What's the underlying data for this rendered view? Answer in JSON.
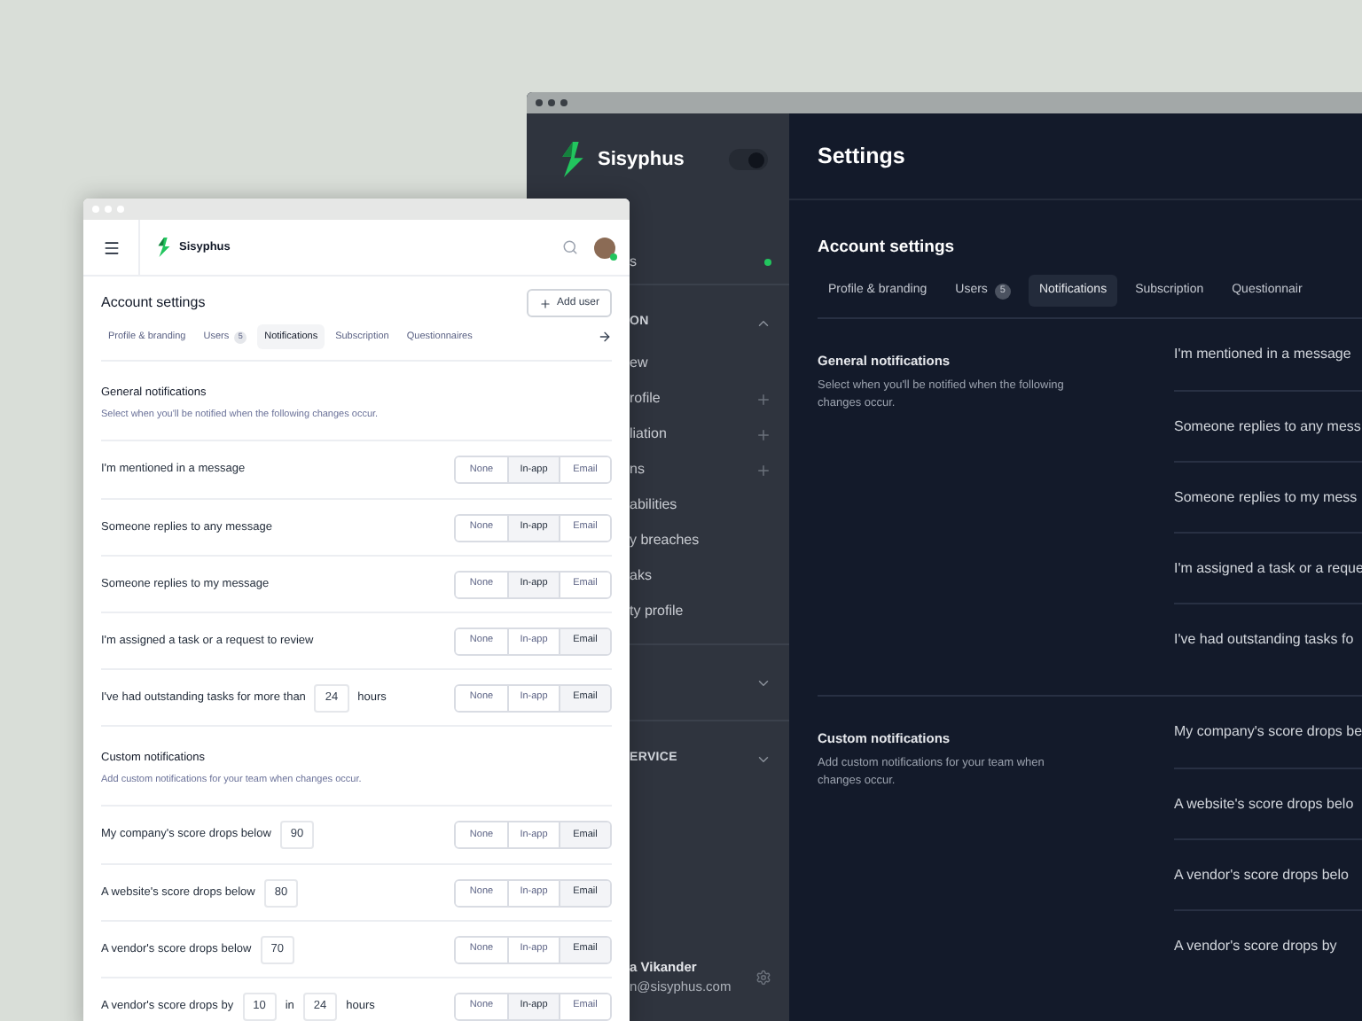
{
  "dark_window": {
    "sidebar": {
      "brand": "Sisyphus",
      "theme_toggle": {
        "on": true
      },
      "items": [
        {
          "kind": "link",
          "text": "s",
          "color": "#22c55e"
        },
        {
          "kind": "section",
          "text": "ON",
          "expanded": true
        },
        {
          "kind": "link",
          "text": "ew"
        },
        {
          "kind": "add",
          "text": "rofile"
        },
        {
          "kind": "add",
          "text": "liation"
        },
        {
          "kind": "add",
          "text": "ns"
        },
        {
          "kind": "link",
          "text": "abilities"
        },
        {
          "kind": "link",
          "text": "y breaches"
        },
        {
          "kind": "link",
          "text": "aks"
        },
        {
          "kind": "link",
          "text": "ty profile"
        },
        {
          "kind": "section",
          "expanded": false
        },
        {
          "kind": "section",
          "text": "ERVICE",
          "expanded": false
        }
      ],
      "user": {
        "name": "a Vikander",
        "email": "n@sisyphus.com"
      }
    },
    "title": "Settings",
    "heading": "Account settings",
    "tabs": [
      {
        "label": "Profile & branding",
        "selected": false
      },
      {
        "label": "Users",
        "count": "5",
        "selected": false
      },
      {
        "label": "Notifications",
        "selected": true
      },
      {
        "label": "Subscription",
        "selected": false
      },
      {
        "label": "Questionnair",
        "selected": false
      }
    ],
    "sections": [
      {
        "title": "General notifications",
        "description": "Select when you'll be notified when the following changes occur.",
        "rows": [
          "I'm mentioned in a message",
          "Someone replies to any mess",
          "Someone replies to my mess",
          "I'm assigned a task or a reque",
          "I've had outstanding tasks fo"
        ]
      },
      {
        "title": "Custom notifications",
        "description": "Add custom notifications for your team when changes occur.",
        "rows": [
          "My company's score drops be",
          "A website's score drops belo",
          "A vendor's score drops belo",
          "A vendor's score drops by"
        ]
      }
    ]
  },
  "light_window": {
    "brand": "Sisyphus",
    "heading": "Account settings",
    "add_button": "Add user",
    "tabs": [
      {
        "label": "Profile & branding",
        "selected": false
      },
      {
        "label": "Users",
        "count": "5",
        "selected": false
      },
      {
        "label": "Notifications",
        "selected": true
      },
      {
        "label": "Subscription",
        "selected": false
      },
      {
        "label": "Questionnaires",
        "selected": false
      }
    ],
    "sections": [
      {
        "title": "General notifications",
        "description": "Select when you'll be notified when the following changes occur.",
        "rows": [
          {
            "parts": [
              {
                "kind": "text",
                "text": "I'm mentioned in a message"
              }
            ],
            "options": [
              {
                "label": "None",
                "selected": false
              },
              {
                "label": "In-app",
                "selected": true
              },
              {
                "label": "Email",
                "selected": false
              }
            ]
          },
          {
            "parts": [
              {
                "kind": "text",
                "text": "Someone replies to any message"
              }
            ],
            "options": [
              {
                "label": "None",
                "selected": false
              },
              {
                "label": "In-app",
                "selected": true
              },
              {
                "label": "Email",
                "selected": false
              }
            ]
          },
          {
            "parts": [
              {
                "kind": "text",
                "text": "Someone replies to my message"
              }
            ],
            "options": [
              {
                "label": "None",
                "selected": false
              },
              {
                "label": "In-app",
                "selected": true
              },
              {
                "label": "Email",
                "selected": false
              }
            ]
          },
          {
            "parts": [
              {
                "kind": "text",
                "text": "I'm assigned a task or a request to review"
              }
            ],
            "options": [
              {
                "label": "None",
                "selected": false
              },
              {
                "label": "In-app",
                "selected": false
              },
              {
                "label": "Email",
                "selected": true
              }
            ]
          },
          {
            "parts": [
              {
                "kind": "text",
                "text": "I've had outstanding tasks for more than"
              },
              {
                "kind": "input",
                "value": "24"
              },
              {
                "kind": "text",
                "text": "hours"
              }
            ],
            "options": [
              {
                "label": "None",
                "selected": false
              },
              {
                "label": "In-app",
                "selected": false
              },
              {
                "label": "Email",
                "selected": true
              }
            ]
          }
        ]
      },
      {
        "title": "Custom notifications",
        "description": "Add custom notifications for your team when changes occur.",
        "rows": [
          {
            "parts": [
              {
                "kind": "text",
                "text": "My company's score drops below"
              },
              {
                "kind": "input",
                "value": "90"
              }
            ],
            "options": [
              {
                "label": "None",
                "selected": false
              },
              {
                "label": "In-app",
                "selected": false
              },
              {
                "label": "Email",
                "selected": true
              }
            ]
          },
          {
            "parts": [
              {
                "kind": "text",
                "text": "A website's score drops below"
              },
              {
                "kind": "input",
                "value": "80"
              }
            ],
            "options": [
              {
                "label": "None",
                "selected": false
              },
              {
                "label": "In-app",
                "selected": false
              },
              {
                "label": "Email",
                "selected": true
              }
            ]
          },
          {
            "parts": [
              {
                "kind": "text",
                "text": "A vendor's score drops below"
              },
              {
                "kind": "input",
                "value": "70"
              }
            ],
            "options": [
              {
                "label": "None",
                "selected": false
              },
              {
                "label": "In-app",
                "selected": false
              },
              {
                "label": "Email",
                "selected": true
              }
            ]
          },
          {
            "parts": [
              {
                "kind": "text",
                "text": "A vendor's score drops by"
              },
              {
                "kind": "input",
                "value": "10"
              },
              {
                "kind": "text",
                "text": "in"
              },
              {
                "kind": "input",
                "value": "24"
              },
              {
                "kind": "text",
                "text": "hours"
              }
            ],
            "options": [
              {
                "label": "None",
                "selected": false
              },
              {
                "label": "In-app",
                "selected": true
              },
              {
                "label": "Email",
                "selected": false
              }
            ]
          }
        ]
      }
    ]
  }
}
